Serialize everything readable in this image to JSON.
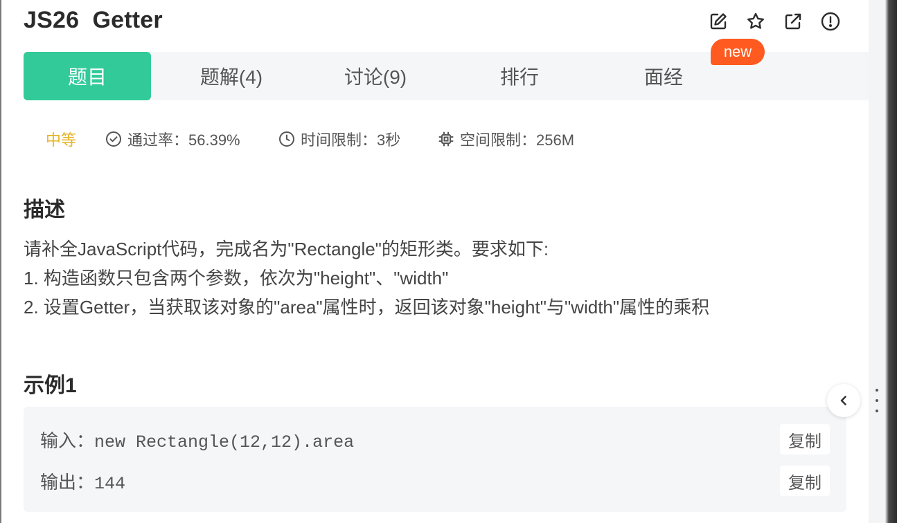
{
  "problem": {
    "title": "JS26  Getter"
  },
  "toolbar": {
    "icons": [
      "edit-icon",
      "star-icon",
      "external-link-icon",
      "report-icon"
    ],
    "new_badge": "new"
  },
  "tabs": [
    {
      "label": "题目",
      "active": true
    },
    {
      "label": "题解(4)",
      "active": false
    },
    {
      "label": "讨论(9)",
      "active": false
    },
    {
      "label": "排行",
      "active": false
    },
    {
      "label": "面经",
      "active": false
    }
  ],
  "meta": {
    "difficulty": "中等",
    "pass_rate": "通过率：56.39%",
    "time_limit": "时间限制：3秒",
    "memory_limit": "空间限制：256M"
  },
  "description": {
    "heading": "描述",
    "lines": [
      "请补全JavaScript代码，完成名为\"Rectangle\"的矩形类。要求如下:",
      "1. 构造函数只包含两个参数，依次为\"height\"、\"width\"",
      "2. 设置Getter，当获取该对象的\"area\"属性时，返回该对象\"height\"与\"width\"属性的乘积"
    ]
  },
  "example": {
    "heading": "示例1",
    "input_label": "输入：",
    "input_value": "new Rectangle(12,12).area",
    "output_label": "输出：",
    "output_value": "144",
    "copy_label": "复制"
  },
  "colors": {
    "accent": "#32ca99",
    "badge": "#ff5a1f",
    "difficulty": "#e6b325"
  }
}
